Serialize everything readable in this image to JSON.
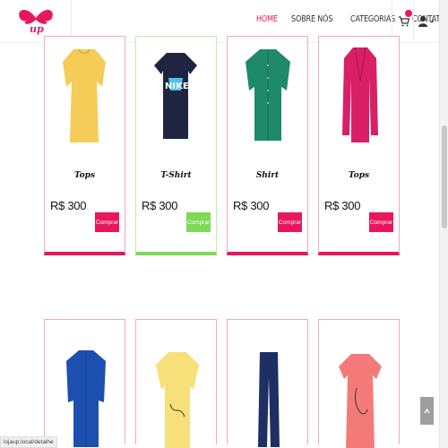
{
  "nav": {
    "items": [
      {
        "label": "HOME",
        "active": true
      },
      {
        "label": "SOBRE NÓS",
        "active": false
      },
      {
        "label": "CATEGORIAS",
        "active": false
      },
      {
        "label": "CONTATO",
        "active": false
      }
    ]
  },
  "logo": {
    "text": "up",
    "icon": "butterfly-logo"
  },
  "cart": {
    "icon": "cart-icon"
  },
  "user": {
    "icon": "user-icon"
  },
  "products_row1": [
    {
      "name": "Tops",
      "price": "R$ 300",
      "button": "Comprar"
    },
    {
      "name": "T-Shirt",
      "price": "R$ 300",
      "button": "Comprar"
    },
    {
      "name": "Shirt",
      "price": "R$ 300",
      "button": "Comprar"
    },
    {
      "name": "Tops",
      "price": "R$ 300",
      "button": "Comprar"
    }
  ],
  "status_url": "lojaup.local/detalhe",
  "colors": {
    "accent": "#e8175d",
    "hover": "#7ed957"
  }
}
